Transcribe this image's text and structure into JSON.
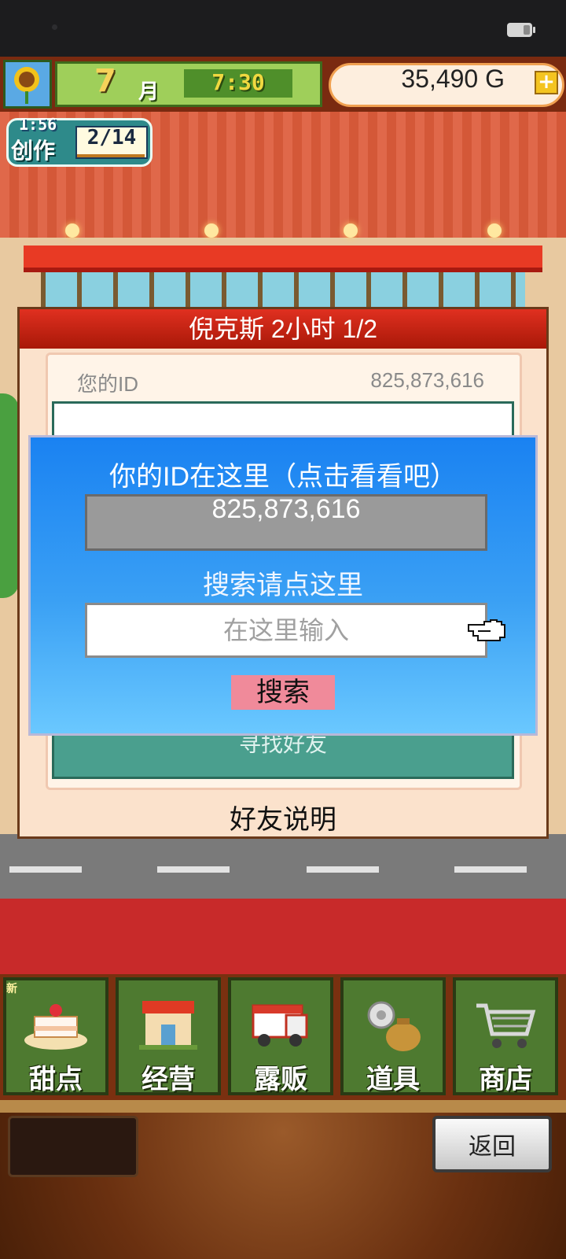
{
  "hud": {
    "month_number": "7",
    "month_label": "月",
    "time": "7:30",
    "money": "35,490 G",
    "money_plus": "+"
  },
  "creation": {
    "timer": "1:56",
    "label": "创作",
    "count": "2/14"
  },
  "friends_panel": {
    "title": "倪克斯  2小时 1/2",
    "your_id_label": "您的ID",
    "your_id_value": "825,873,616",
    "find_friends": "寻找好友",
    "friend_help": "好友说明"
  },
  "search_dialog": {
    "title": "你的ID在这里（点击看看吧）",
    "id_value": "825,873,616",
    "search_hint": "搜索请点这里",
    "input_placeholder": "在这里输入",
    "input_value": "",
    "search_button": "搜索"
  },
  "bottom_nav": {
    "new_badge": "新",
    "items": [
      {
        "label": "甜点",
        "icon": "cake-icon"
      },
      {
        "label": "经营",
        "icon": "shop-icon"
      },
      {
        "label": "露贩",
        "icon": "food-truck-icon"
      },
      {
        "label": "道具",
        "icon": "items-bag-icon"
      },
      {
        "label": "商店",
        "icon": "shopping-cart-icon"
      }
    ]
  },
  "footer": {
    "back_button": "返回"
  },
  "colors": {
    "dialog_top": "#1a82f2",
    "dialog_bottom": "#6ac8ff",
    "panel_header": "#e03020",
    "search_button": "#f08a9a",
    "nav_button": "#4e7a30"
  }
}
